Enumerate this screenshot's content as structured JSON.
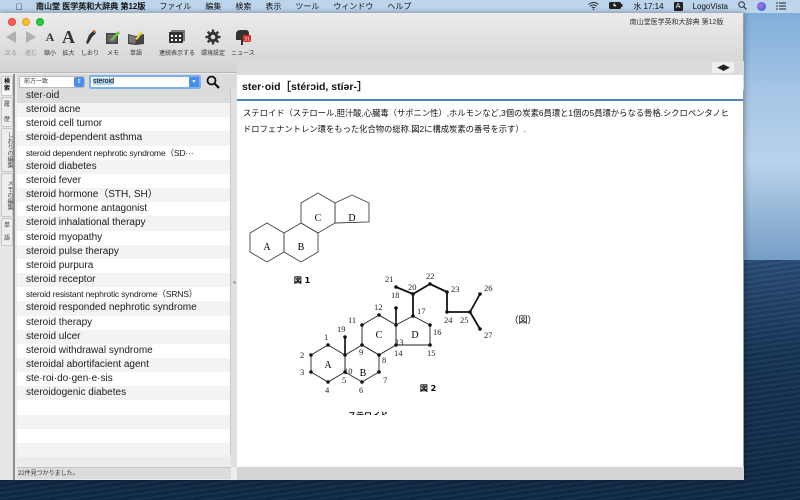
{
  "menubar": {
    "apple": "",
    "app_name": "南山堂 医学英和大辞典 第12版",
    "menus": [
      "ファイル",
      "編集",
      "検索",
      "表示",
      "ツール",
      "ウィンドウ",
      "ヘルプ"
    ],
    "clock": "水 17:14",
    "input_mode": "A",
    "user": "LogoVista",
    "status_icons": [
      "wifi-icon",
      "battery-icon",
      "spotlight-icon",
      "siri-icon",
      "notification-center-icon"
    ]
  },
  "window": {
    "title": "南山堂医学英和大辞典 第12版",
    "toolbar": [
      {
        "id": "back",
        "label": "戻る",
        "icon": "back-arrow-icon",
        "enabled": false
      },
      {
        "id": "forward",
        "label": "進む",
        "icon": "forward-arrow-icon",
        "enabled": false
      },
      {
        "id": "shrink",
        "label": "縮小",
        "icon": "font-small-icon",
        "enabled": true
      },
      {
        "id": "enlarge",
        "label": "拡大",
        "icon": "font-large-icon",
        "enabled": true
      },
      {
        "id": "bookmark",
        "label": "しおり",
        "icon": "bookmark-icon",
        "enabled": true
      },
      {
        "id": "memo",
        "label": "メモ",
        "icon": "memo-icon",
        "enabled": true
      },
      {
        "id": "wordbook",
        "label": "単語",
        "icon": "wordbook-icon",
        "enabled": true
      },
      {
        "id": "continuous",
        "label": "連続表示する",
        "icon": "continuous-view-icon",
        "enabled": true
      },
      {
        "id": "settings",
        "label": "環境設定",
        "icon": "gear-icon",
        "enabled": true
      },
      {
        "id": "news",
        "label": "ニュース",
        "icon": "news-mailbox-icon",
        "enabled": true
      }
    ]
  },
  "side_tabs": [
    "検",
    "索",
    "履",
    "歴",
    "しおりの編集",
    "メモの編集",
    "単",
    "語"
  ],
  "search": {
    "mode": "前方一致",
    "query": "steroid",
    "button_icon": "magnifier-icon"
  },
  "results": {
    "items": [
      "ster·oid",
      "steroid acne",
      "steroid cell tumor",
      "steroid-dependent asthma",
      "steroid dependent nephrotic syndrome（SD···",
      "steroid diabetes",
      "steroid fever",
      "steroid hormone（STH, SH）",
      "steroid hormone antagonist",
      "steroid inhalational therapy",
      "steroid myopathy",
      "steroid pulse therapy",
      "steroid purpura",
      "steroid receptor",
      "steroid resistant nephrotic syndrome（SRNS）",
      "steroid responded nephrotic syndrome",
      "steroid therapy",
      "steroid ulcer",
      "steroid withdrawal syndrome",
      "steroidal abortifacient agent",
      "ste·roi·do·gen·e·sis",
      "steroidogenic diabetes"
    ],
    "selected_index": 0,
    "status": "22件見つかりました。"
  },
  "entry": {
    "nav": "⇦⇨",
    "headword": "ster·oid［stérɔid, stíər-］",
    "definition": "ステロイド（ステロール,胆汁酸,心臓毒（サポニン性）,ホルモンなど,3個の炭素6員環と1個の5員環からなる骨格.シクロペンタノヒドロフェナントレン環をもった化合物の総称.図2に構成炭素の番号を示す）.",
    "figure1": {
      "caption": "図 1",
      "rings": [
        "A",
        "B",
        "C",
        "D"
      ]
    },
    "figure2": {
      "caption": "図 2",
      "name": "ステロイド",
      "rings": [
        "A",
        "B",
        "C",
        "D"
      ],
      "atoms": [
        "1",
        "2",
        "3",
        "4",
        "5",
        "6",
        "7",
        "8",
        "9",
        "10",
        "11",
        "12",
        "13",
        "14",
        "15",
        "16",
        "17",
        "18",
        "19",
        "20",
        "21",
        "22",
        "23",
        "24",
        "25",
        "26",
        "27"
      ]
    },
    "figure_label": "（図）"
  }
}
